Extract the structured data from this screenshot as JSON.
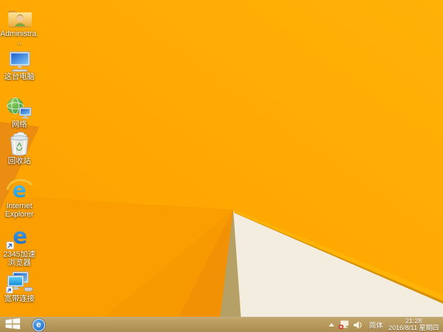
{
  "desktop": {
    "icons": [
      {
        "id": "user-folder",
        "icon": "user-folder-icon",
        "label": "Administra..."
      },
      {
        "id": "this-pc",
        "icon": "computer-icon",
        "label": "这台电脑"
      },
      {
        "id": "network",
        "icon": "network-globe-icon",
        "label": "网络"
      },
      {
        "id": "recycle-bin",
        "icon": "recycle-bin-full-icon",
        "label": "回收站"
      },
      {
        "id": "internet-explorer",
        "icon": "ie-e-icon",
        "label": "Internet Explorer"
      },
      {
        "id": "browser-2345",
        "icon": "blue-e-shortcut-icon",
        "label": "2345加速浏览器"
      },
      {
        "id": "broadband",
        "icon": "broadband-monitors-icon",
        "label": "宽带连接"
      }
    ]
  },
  "taskbar": {
    "start_icon": "windows-logo-icon",
    "pinned_browser_icon": "blue-e-circle-icon",
    "tray": {
      "hidden_icons_icon": "show-hidden-icons-chevron",
      "network_icon": "network-disconnected-icon",
      "volume_icon": "speaker-icon",
      "ime_label": "简体",
      "time": "21:28",
      "date": "2016/8/11 星期四"
    }
  },
  "colors": {
    "wallpaper_orange": "#FFA802",
    "wallpaper_dark_wedge": "#EB8D10",
    "wallpaper_khaki": "#B5A065",
    "wallpaper_cream": "#F3EDDF",
    "taskbar_tan": "#B3945B",
    "ie_blue": "#1990D8",
    "browser_2345_blue": "#1B67C6",
    "network_error_red": "#D93025"
  }
}
